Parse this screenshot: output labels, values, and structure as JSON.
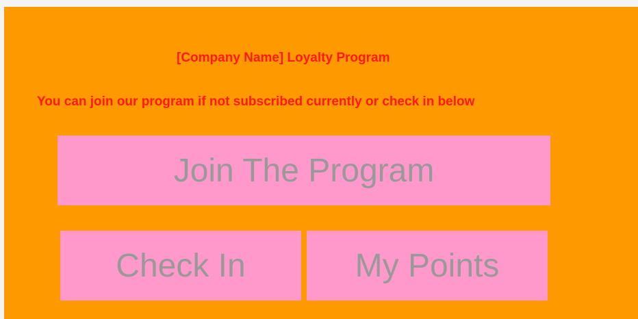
{
  "header": {
    "title": "[Company Name] Loyalty Program",
    "subtitle": "You can join our program if not subscribed currently or check in below"
  },
  "actions": {
    "join_label": "Join The Program",
    "checkin_label": "Check In",
    "points_label": "My Points"
  },
  "colors": {
    "background": "#ff9900",
    "text_accent": "#ff1a1a",
    "button_bg": "#ff99cc",
    "button_text": "#999999"
  }
}
